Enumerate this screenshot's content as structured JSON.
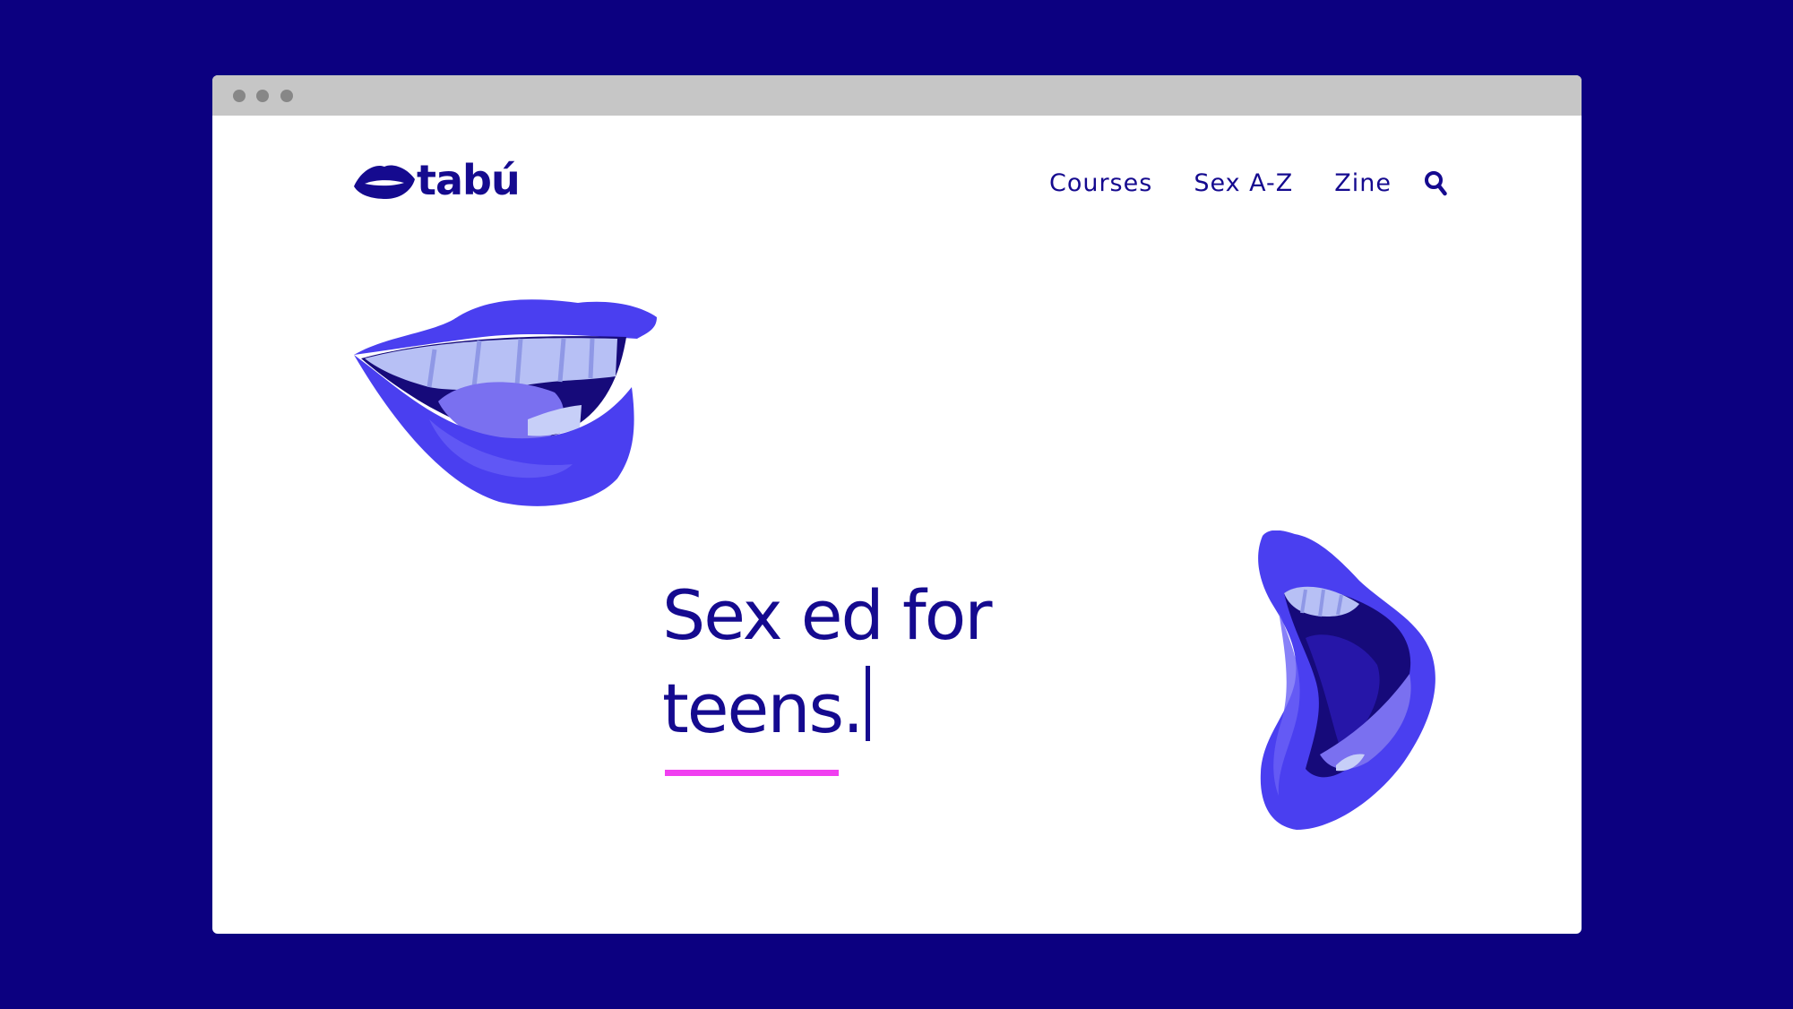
{
  "brand": {
    "name": "tabú"
  },
  "nav": {
    "items": [
      {
        "label": "Courses"
      },
      {
        "label": "Sex A-Z"
      },
      {
        "label": "Zine"
      }
    ],
    "search_icon": "search-icon"
  },
  "hero": {
    "line1": "Sex ed for",
    "line2": "teens."
  },
  "colors": {
    "background": "#0c0080",
    "brand_text": "#150a8f",
    "lip_primary": "#4a3ff0",
    "accent_underline": "#f03ff0",
    "titlebar": "#c6c6c6"
  }
}
